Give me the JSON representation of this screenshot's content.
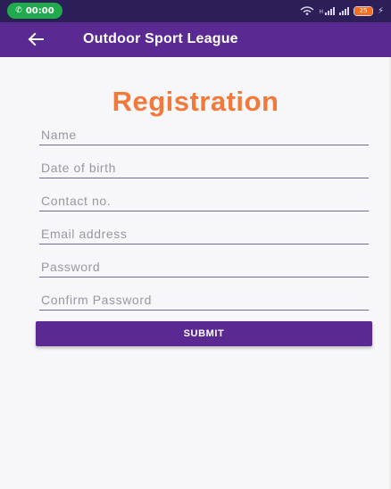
{
  "colors": {
    "status_bar": "#2c1e57",
    "app_bar": "#5a2a92",
    "title_accent": "#f3793a",
    "call_pill": "#1faa4d",
    "underline": "#6f6a98",
    "button": "#5a2a92"
  },
  "status_bar": {
    "call_time": "00:00",
    "call_icon": "phone-icon",
    "battery_level": "25",
    "icons": [
      "wifi-icon",
      "signal-icon",
      "signal-icon",
      "battery-icon",
      "charging-icon"
    ]
  },
  "app_bar": {
    "back_icon": "arrow-left-icon",
    "title": "Outdoor Sport League"
  },
  "form": {
    "title": "Registration",
    "fields": [
      {
        "name": "name",
        "placeholder": "Name",
        "value": ""
      },
      {
        "name": "dob",
        "placeholder": "Date of birth",
        "value": ""
      },
      {
        "name": "contact",
        "placeholder": "Contact no.",
        "value": ""
      },
      {
        "name": "email",
        "placeholder": "Email address",
        "value": ""
      },
      {
        "name": "password",
        "placeholder": "Password",
        "value": ""
      },
      {
        "name": "confirm",
        "placeholder": "Confirm Password",
        "value": ""
      }
    ],
    "submit_label": "SUBMIT"
  }
}
